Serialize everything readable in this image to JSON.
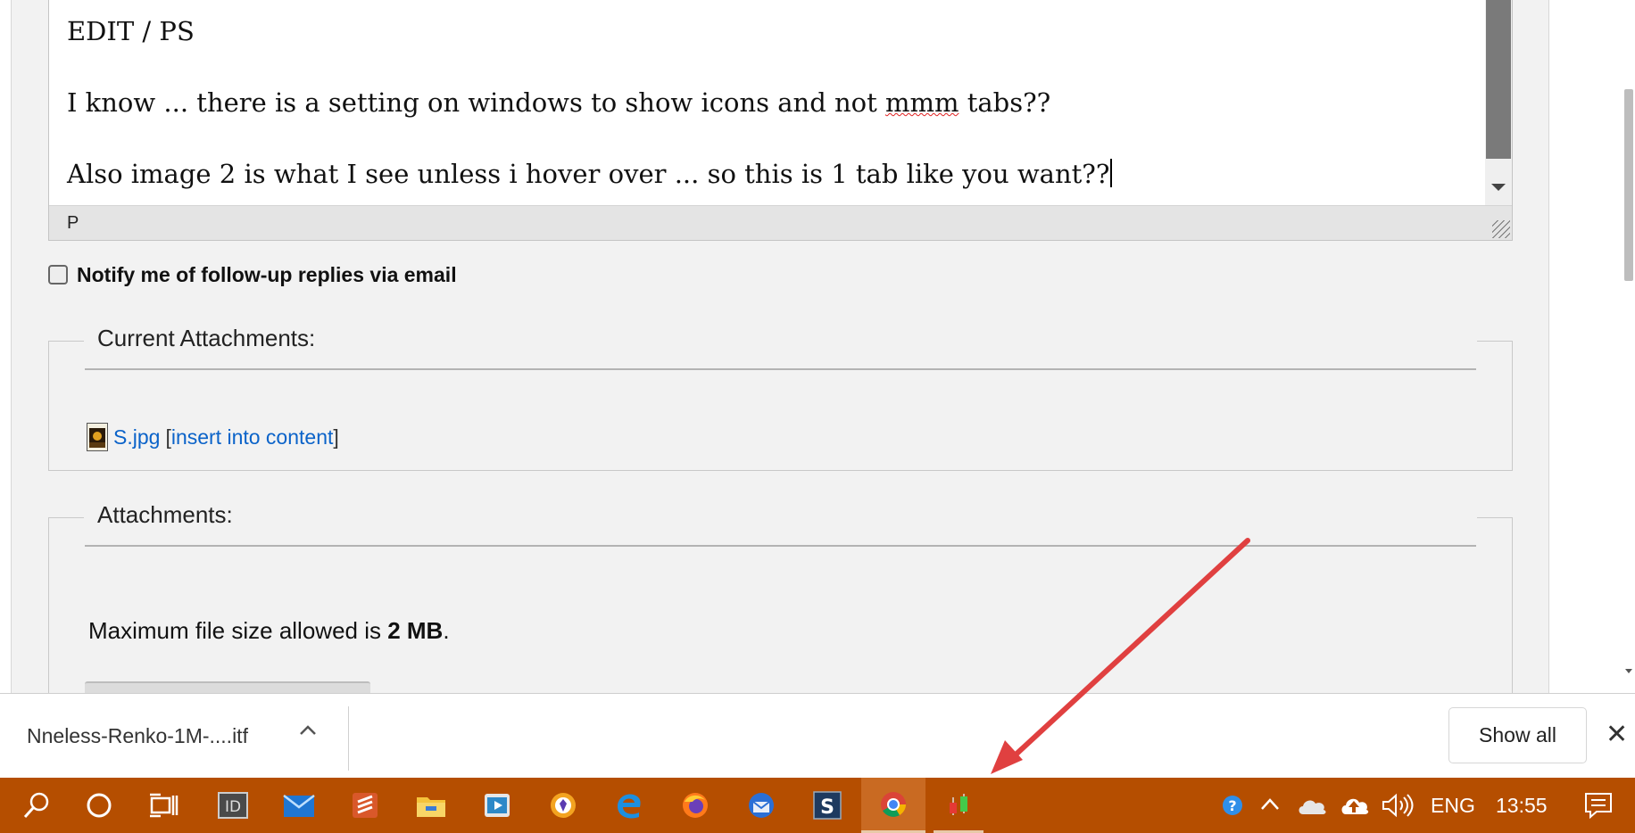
{
  "editor": {
    "lines": [
      "EDIT / PS",
      "I know ... there is a setting on windows to show icons and not",
      "tabs??",
      "Also image 2 is what I see unless i hover over ... so this is 1 tab like you want??"
    ],
    "misspelled_word": "mmm",
    "status_path": "P"
  },
  "notify": {
    "label": "Notify me of follow-up replies via email",
    "checked": false
  },
  "current_attachments": {
    "legend": "Current Attachments:",
    "file_name": "S.jpg",
    "insert_link": "insert into content",
    "bracket_open": "[",
    "bracket_close": "]"
  },
  "attachments": {
    "legend": "Attachments:",
    "max_size_prefix": "Maximum file size allowed is",
    "max_size_value": "2 MB",
    "max_size_suffix": "."
  },
  "download_bar": {
    "file_name": "Nneless-Renko-1M-....itf",
    "show_all_label": "Show all",
    "close_glyph": "✕"
  },
  "taskbar": {
    "icons": [
      "search-icon",
      "cortana-icon",
      "task-view-icon",
      "indesign-icon",
      "mail-icon",
      "sublime-icon",
      "file-explorer-icon",
      "video-player-icon",
      "brave-icon",
      "edge-icon",
      "firefox-icon",
      "thunderbird-icon",
      "snagit-icon",
      "chrome-icon",
      "trading-chart-icon"
    ],
    "active_app": "chrome-icon",
    "language": "ENG",
    "time": "13:55",
    "accent_color": "#b54e00"
  },
  "annotation": {
    "arrow_color": "#e04040"
  }
}
